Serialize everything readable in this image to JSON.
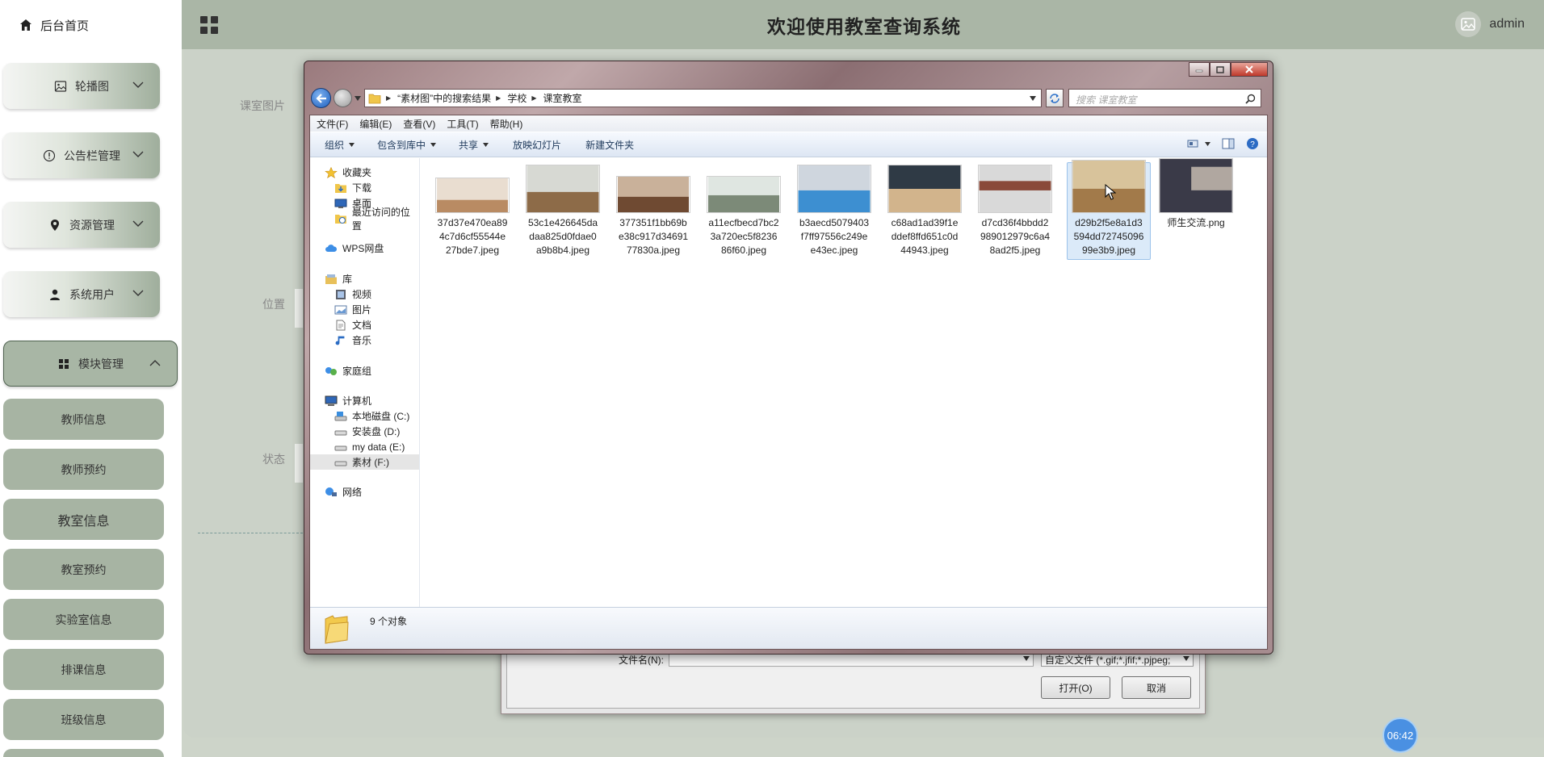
{
  "header": {
    "home_tab": "后台首页",
    "title": "欢迎使用教室查询系统",
    "username": "admin"
  },
  "sidebar": {
    "menus": [
      {
        "label": "轮播图",
        "icon": "image-icon"
      },
      {
        "label": "公告栏管理",
        "icon": "info-circle-icon"
      },
      {
        "label": "资源管理",
        "icon": "location-pin-icon"
      },
      {
        "label": "系统用户",
        "icon": "user-icon"
      },
      {
        "label": "模块管理",
        "icon": "grid-icon",
        "expanded": true
      }
    ],
    "submenu": [
      "教师信息",
      "教师预约",
      "教室信息",
      "教室预约",
      "实验室信息",
      "排课信息",
      "班级信息"
    ]
  },
  "form": {
    "labels": [
      "课室图片",
      "位置",
      "状态"
    ]
  },
  "clock": "06:42",
  "open_dialog": {
    "filename_label": "文件名(N):",
    "filename_value": "",
    "filetype_value": "自定义文件 (*.gif;*.jfif;*.pjpeg;",
    "open_button": "打开(O)",
    "cancel_button": "取消"
  },
  "explorer": {
    "breadcrumbs": [
      "“素材图”中的搜索结果",
      "学校",
      "课室教室"
    ],
    "search_placeholder": "搜索 课室教室",
    "menubar": [
      "文件(F)",
      "编辑(E)",
      "查看(V)",
      "工具(T)",
      "帮助(H)"
    ],
    "toolbar": [
      "组织",
      "包含到库中",
      "共享",
      "放映幻灯片",
      "新建文件夹"
    ],
    "nav": {
      "favorites": "收藏夹",
      "downloads": "下载",
      "desktop": "桌面",
      "recent": "最近访问的位置",
      "wps": "WPS网盘",
      "library": "库",
      "videos": "视频",
      "pictures": "图片",
      "documents": "文档",
      "music": "音乐",
      "homegroup": "家庭组",
      "computer": "计算机",
      "drive_c": "本地磁盘 (C:)",
      "drive_d": "安装盘 (D:)",
      "drive_e": "my data (E:)",
      "drive_f": "素材 (F:)",
      "network": "网络"
    },
    "files": [
      {
        "name": "37d37e470ea894c7d6cf55544e27bde7.jpeg",
        "colors": [
          "#e9ddd0",
          "#b98b63"
        ]
      },
      {
        "name": "53c1e426645dadaa825d0fdae0a9b8b4.jpeg",
        "colors": [
          "#d7d9d3",
          "#8d6b48"
        ]
      },
      {
        "name": "377351f1bb69be38c917d3469177830a.jpeg",
        "colors": [
          "#c9b19a",
          "#6f4a32"
        ]
      },
      {
        "name": "a11ecfbecd7bc23a720ec5f823686f60.jpeg",
        "colors": [
          "#dfe6e1",
          "#7c8a78"
        ]
      },
      {
        "name": "b3aecd5079403f7ff97556c249ee43ec.jpeg",
        "colors": [
          "#cfd6de",
          "#3d8fd1"
        ]
      },
      {
        "name": "c68ad1ad39f1eddef8ffd651c0d44943.jpeg",
        "colors": [
          "#2f3a45",
          "#d2b48c"
        ]
      },
      {
        "name": "d7cd36f4bbdd2989012979c6a48ad2f5.jpeg",
        "colors": [
          "#d9d9d9",
          "#8a4a3a"
        ]
      },
      {
        "name": "d29b2f5e8a1d3594dd7274509699e3b9.jpeg",
        "colors": [
          "#d8c39b",
          "#a27a4a"
        ]
      },
      {
        "name": "师生交流.png",
        "colors": [
          "#3a3a48",
          "#b0a7a0"
        ]
      }
    ],
    "status": "9 个对象"
  }
}
